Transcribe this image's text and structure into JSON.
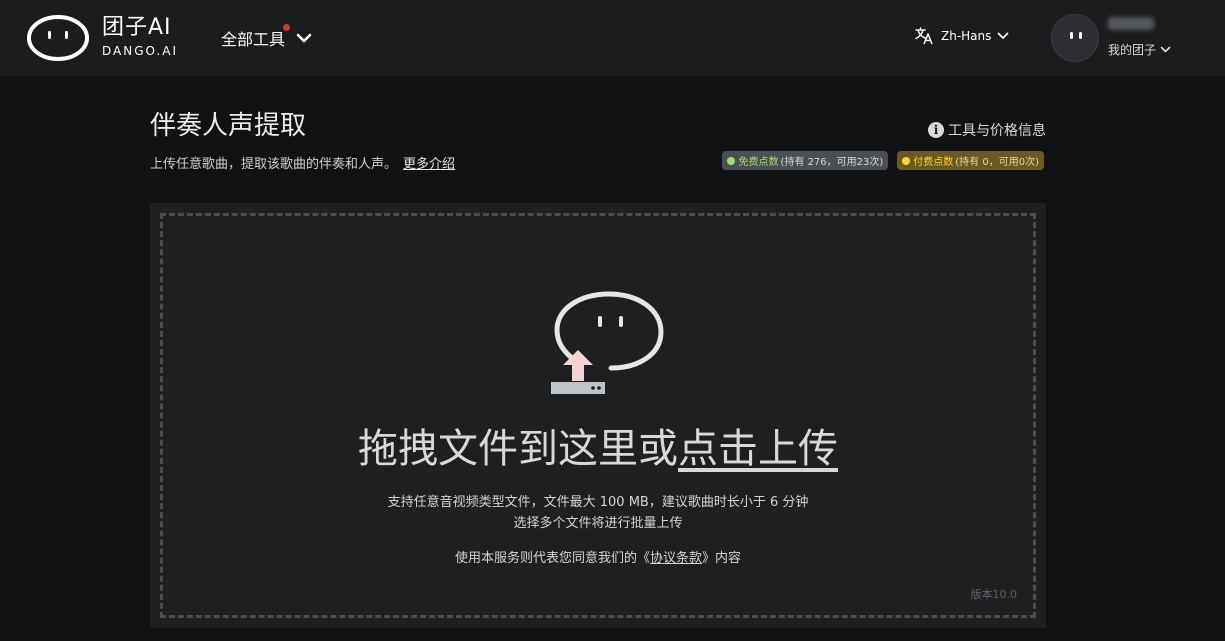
{
  "header": {
    "brand_cn": "团子AI",
    "brand_en": "DANGO.AI",
    "tools_label": "全部工具",
    "lang_label": "Zh-Hans",
    "user_menu_label": "我的团子"
  },
  "page": {
    "title": "伴奏人声提取",
    "subtitle": "上传任意歌曲，提取该歌曲的伴奏和人声。",
    "more_link": "更多介绍",
    "info_link": "工具与价格信息"
  },
  "badges": {
    "free_name": "免费点数",
    "free_detail": "(持有 276，可用23次)",
    "paid_name": "付费点数",
    "paid_detail": "(持有 0，可用0次)"
  },
  "upload": {
    "drop_text": "拖拽文件到这里或",
    "click_text": "点击上传",
    "hint1": "支持任意音视频类型文件，文件最大 100 MB，建议歌曲时长小于 6 分钟",
    "hint2": "选择多个文件将进行批量上传",
    "agree_prefix": "使用本服务则代表您同意我们的《",
    "terms_link": "协议条款",
    "agree_suffix": "》内容",
    "version": "版本10.0"
  },
  "colors": {
    "header_bg": "#1b1c1e",
    "page_bg": "#111213",
    "panel_bg": "#1e1f21",
    "free_dot": "#9ee06d",
    "paid_dot": "#ffd23a",
    "notify_dot": "#e0302e"
  },
  "icons": {
    "logo": "dango-face-logo",
    "tools": "chevron-down-icon",
    "lang": "translate-icon",
    "info": "info-circle-icon",
    "upload": "upload-arrow-icon"
  }
}
